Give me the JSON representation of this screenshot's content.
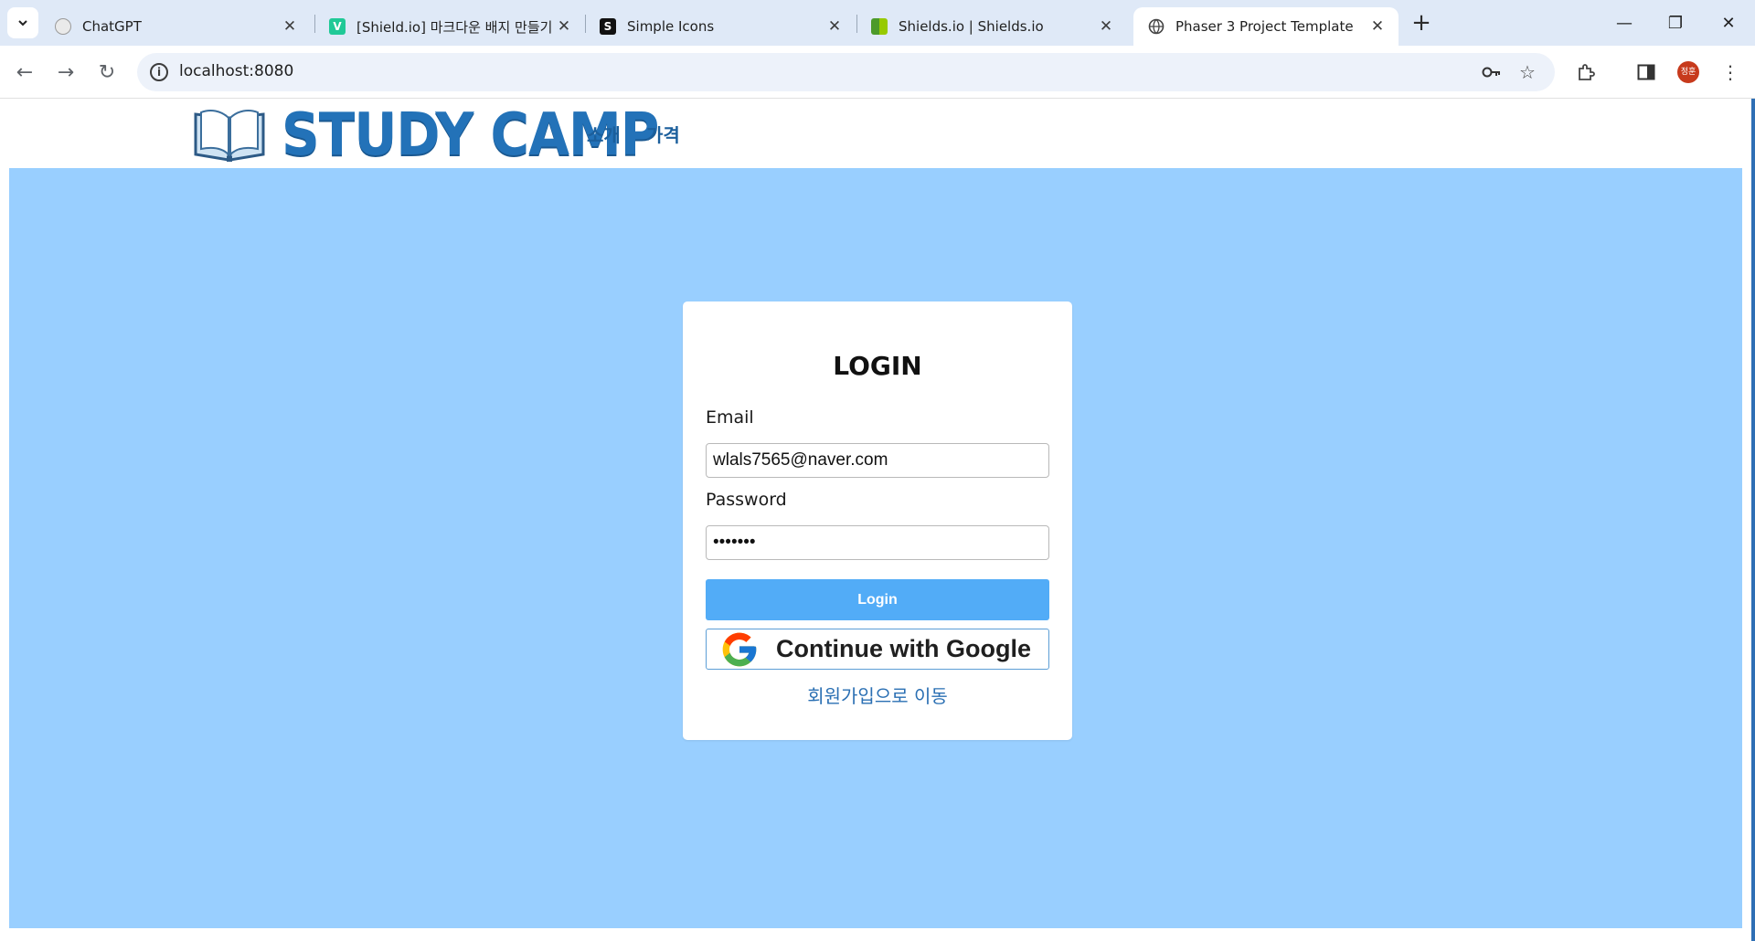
{
  "browser": {
    "tabs": [
      {
        "title": "ChatGPT",
        "favicon": "chatgpt-icon"
      },
      {
        "title": "[Shield.io] 마크다운 배지 만들기",
        "favicon": "velog-icon"
      },
      {
        "title": "Simple Icons",
        "favicon": "simple-icons-icon"
      },
      {
        "title": "Shields.io | Shields.io",
        "favicon": "shields-icon"
      },
      {
        "title": "Phaser 3 Project Template",
        "favicon": "globe-icon"
      }
    ],
    "active_tab_index": 4,
    "url": "localhost:8080",
    "profile_initials": "정훈"
  },
  "site": {
    "logo_text": "STUDY CAMP",
    "nav": [
      "소개",
      "가격"
    ],
    "accent_color": "#2372b8",
    "hero_color": "#99cfff"
  },
  "login": {
    "title": "LOGIN",
    "email_label": "Email",
    "email_value": "wlals7565@naver.com",
    "password_label": "Password",
    "password_value": "•••••••",
    "login_button": "Login",
    "google_button": "Continue with Google",
    "signup_link": "회원가입으로 이동",
    "button_color": "#52acf7"
  }
}
